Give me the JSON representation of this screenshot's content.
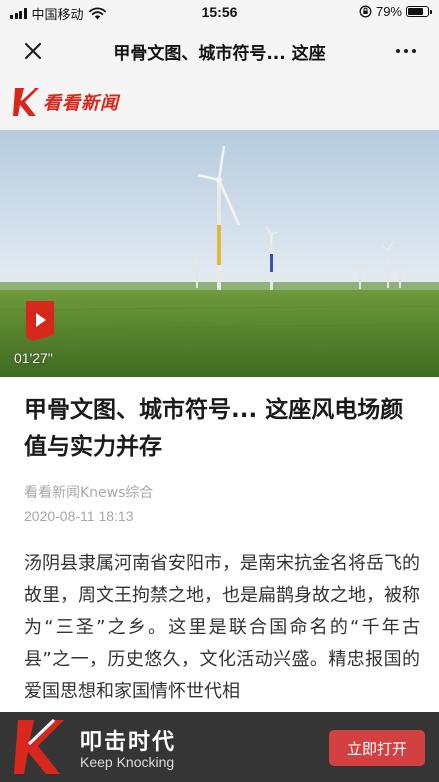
{
  "status_bar": {
    "carrier": "中国移动",
    "time": "15:56",
    "battery": "79%",
    "battery_level": 0.79
  },
  "nav": {
    "close_icon": "close-icon",
    "title": "甲骨文图、城市符号... 这座",
    "more_icon": "more-icon"
  },
  "brand": {
    "name": "看看新闻",
    "color": "#d8281d"
  },
  "video": {
    "duration": "01'27\"",
    "play_icon": "play-icon"
  },
  "article": {
    "title": "甲骨文图、城市符号... 这座风电场颜值与实力并存",
    "source": "看看新闻Knews综合",
    "date": "2020-08-11 18:13",
    "body": "汤阴县隶属河南省安阳市，是南宋抗金名将岳飞的故里，周文王拘禁之地，也是扁鹊身故之地，被称为“三圣”之乡。这里是联合国命名的“千年古县”之一，历史悠久，文化活动兴盛。精忠报国的爱国思想和家国情怀世代相"
  },
  "banner": {
    "title": "叩击时代",
    "subtitle": "Keep Knocking",
    "open_label": "立即打开",
    "accent": "#d24040"
  }
}
